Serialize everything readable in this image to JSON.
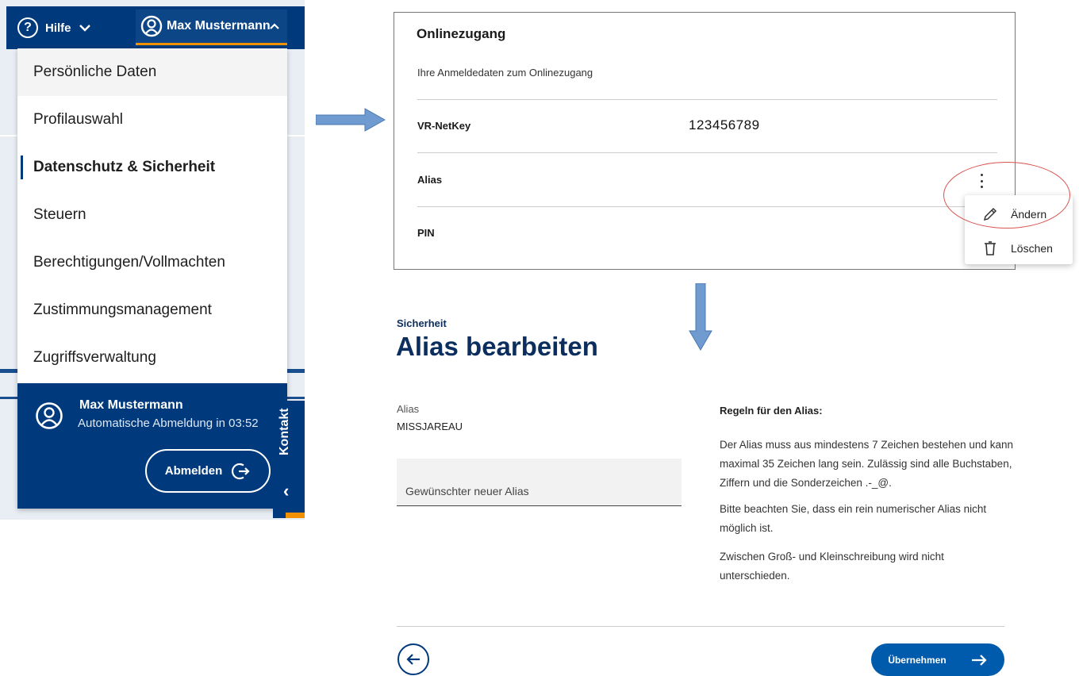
{
  "header": {
    "help_label": "Hilfe",
    "user_name": "Max Mustermann"
  },
  "menu": {
    "items": [
      {
        "label": "Persönliche Daten"
      },
      {
        "label": "Profilauswahl"
      },
      {
        "label": "Datenschutz & Sicherheit",
        "active": true
      },
      {
        "label": "Steuern"
      },
      {
        "label": "Berechtigungen/Vollmachten"
      },
      {
        "label": "Zustimmungsmanagement"
      },
      {
        "label": "Zugriffsverwaltung"
      }
    ],
    "footer": {
      "user_name": "Max Mustermann",
      "logout_timer": "Automatische Abmeldung in 03:52",
      "logout_label": "Abmelden"
    },
    "contact_tab": "Kontakt"
  },
  "online_access": {
    "title": "Onlinezugang",
    "subtitle": "Ihre Anmeldedaten zum Onlinezugang",
    "rows": [
      {
        "label": "VR-NetKey",
        "value": "123456789"
      },
      {
        "label": "Alias",
        "value": ""
      },
      {
        "label": "PIN",
        "value": ""
      }
    ],
    "context_menu": [
      {
        "label": "Ändern",
        "icon": "pencil-icon"
      },
      {
        "label": "Löschen",
        "icon": "trash-icon"
      }
    ]
  },
  "alias_edit": {
    "eyebrow": "Sicherheit",
    "title": "Alias bearbeiten",
    "current_label": "Alias",
    "current_value": "MISSJAREAU",
    "new_alias_placeholder": "Gewünschter neuer Alias",
    "rules_title": "Regeln für den Alias:",
    "rules": [
      "Der Alias muss aus mindestens 7 Zeichen bestehen und kann maximal 35 Zeichen lang sein. Zulässig sind alle Buchstaben, Ziffern und die Sonderzeichen .-_@.",
      "Bitte beachten Sie, dass ein rein numerischer Alias nicht möglich ist.",
      "Zwischen Groß- und Kleinschreibung wird nicht unterschieden."
    ],
    "submit_label": "Übernehmen"
  },
  "colors": {
    "brand_blue": "#003a7d",
    "accent_orange": "#f29100",
    "button_blue": "#005bac",
    "annotation_red": "#d9534f",
    "arrow_blue": "#6f9bd1"
  }
}
